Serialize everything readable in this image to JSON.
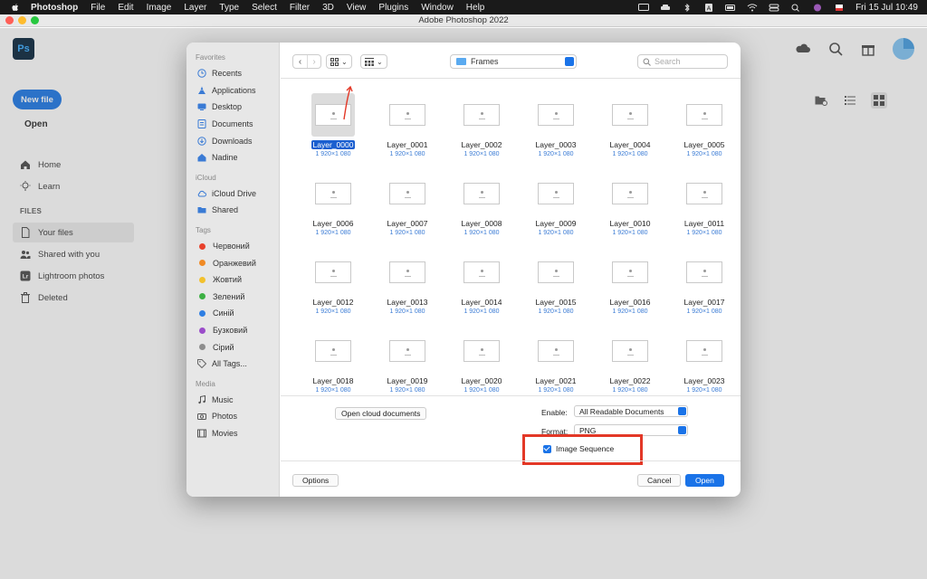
{
  "menubar": {
    "items": [
      "Photoshop",
      "File",
      "Edit",
      "Image",
      "Layer",
      "Type",
      "Select",
      "Filter",
      "3D",
      "View",
      "Plugins",
      "Window",
      "Help"
    ],
    "clock": "Fri 15 Jul  10:49"
  },
  "window": {
    "title": "Adobe Photoshop 2022"
  },
  "home": {
    "logo": "Ps",
    "new_file": "New file",
    "open": "Open",
    "nav": {
      "home": "Home",
      "learn": "Learn"
    },
    "files_section": "FILES",
    "files": {
      "your_files": "Your files",
      "shared": "Shared with you",
      "lightroom": "Lightroom photos",
      "deleted": "Deleted"
    },
    "lightroom_badge": "Lr"
  },
  "dialog": {
    "sidebar": {
      "favorites_label": "Favorites",
      "favorites": [
        "Recents",
        "Applications",
        "Desktop",
        "Documents",
        "Downloads",
        "Nadine"
      ],
      "icloud_label": "iCloud",
      "icloud": [
        "iCloud Drive",
        "Shared"
      ],
      "tags_label": "Tags",
      "tags": [
        {
          "label": "Червоний",
          "color": "#e8412c"
        },
        {
          "label": "Оранжевий",
          "color": "#f08a24"
        },
        {
          "label": "Жовтий",
          "color": "#f2c12e"
        },
        {
          "label": "Зелений",
          "color": "#3cb043"
        },
        {
          "label": "Синій",
          "color": "#2f7fe3"
        },
        {
          "label": "Бузковий",
          "color": "#9b4dca"
        },
        {
          "label": "Сірий",
          "color": "#8e8e8e"
        }
      ],
      "all_tags": "All Tags...",
      "media_label": "Media",
      "media": [
        "Music",
        "Photos",
        "Movies"
      ]
    },
    "toolbar": {
      "folder": "Frames",
      "search_placeholder": "Search"
    },
    "files": [
      {
        "name": "Layer_0000",
        "dims": "1 920×1 080"
      },
      {
        "name": "Layer_0001",
        "dims": "1 920×1 080"
      },
      {
        "name": "Layer_0002",
        "dims": "1 920×1 080"
      },
      {
        "name": "Layer_0003",
        "dims": "1 920×1 080"
      },
      {
        "name": "Layer_0004",
        "dims": "1 920×1 080"
      },
      {
        "name": "Layer_0005",
        "dims": "1 920×1 080"
      },
      {
        "name": "Layer_0006",
        "dims": "1 920×1 080"
      },
      {
        "name": "Layer_0007",
        "dims": "1 920×1 080"
      },
      {
        "name": "Layer_0008",
        "dims": "1 920×1 080"
      },
      {
        "name": "Layer_0009",
        "dims": "1 920×1 080"
      },
      {
        "name": "Layer_0010",
        "dims": "1 920×1 080"
      },
      {
        "name": "Layer_0011",
        "dims": "1 920×1 080"
      },
      {
        "name": "Layer_0012",
        "dims": "1 920×1 080"
      },
      {
        "name": "Layer_0013",
        "dims": "1 920×1 080"
      },
      {
        "name": "Layer_0014",
        "dims": "1 920×1 080"
      },
      {
        "name": "Layer_0015",
        "dims": "1 920×1 080"
      },
      {
        "name": "Layer_0016",
        "dims": "1 920×1 080"
      },
      {
        "name": "Layer_0017",
        "dims": "1 920×1 080"
      },
      {
        "name": "Layer_0018",
        "dims": "1 920×1 080"
      },
      {
        "name": "Layer_0019",
        "dims": "1 920×1 080"
      },
      {
        "name": "Layer_0020",
        "dims": "1 920×1 080"
      },
      {
        "name": "Layer_0021",
        "dims": "1 920×1 080"
      },
      {
        "name": "Layer_0022",
        "dims": "1 920×1 080"
      },
      {
        "name": "Layer_0023",
        "dims": "1 920×1 080"
      }
    ],
    "selected_file": "Layer_0000",
    "options": {
      "cloud_button": "Open cloud documents",
      "enable_label": "Enable:",
      "enable_value": "All Readable Documents",
      "format_label": "Format:",
      "format_value": "PNG",
      "image_sequence": "Image Sequence",
      "image_sequence_checked": true
    },
    "footer": {
      "options": "Options",
      "cancel": "Cancel",
      "open": "Open"
    }
  },
  "colors": {
    "accent": "#1a73e8",
    "highlight": "#e33827",
    "ps_blue": "#31a8ff",
    "new_file": "#1473e6"
  }
}
